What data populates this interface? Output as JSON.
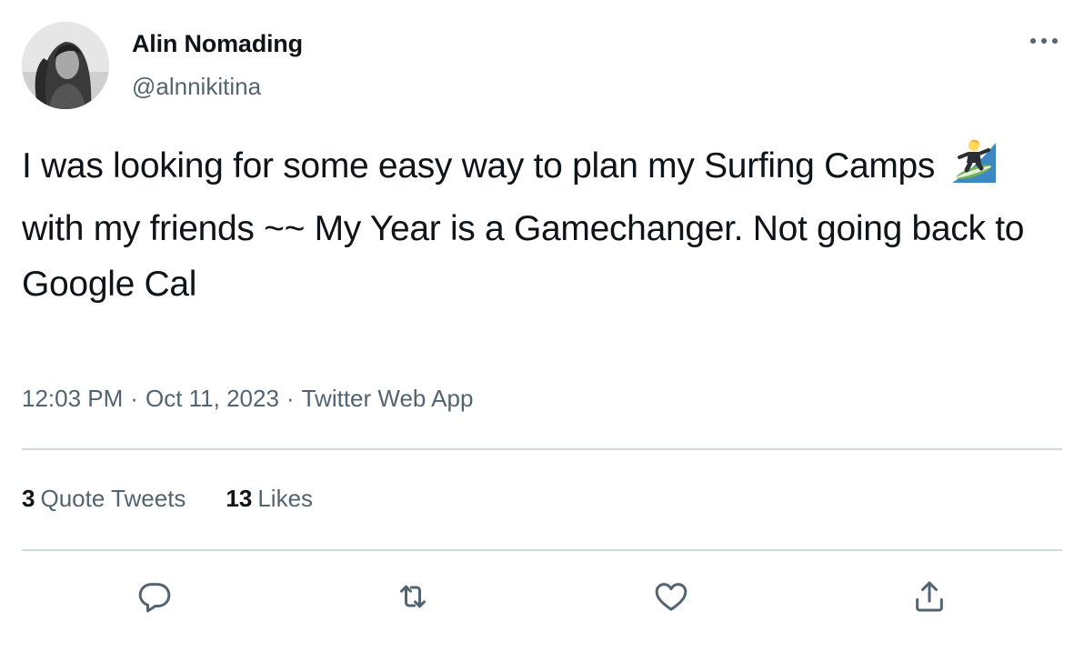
{
  "author": {
    "name": "Alin Nomading",
    "handle": "@alnnikitina"
  },
  "tweet": {
    "text_part1": "I was looking for some easy way to plan my Surfing Camps",
    "emoji": "surfer-emoji",
    "text_part2": "with my friends ~~ My Year is a Gamechanger. Not going back to Google Cal"
  },
  "meta": {
    "time": "12:03 PM",
    "separator": "·",
    "date": "Oct 11, 2023",
    "source": "Twitter Web App"
  },
  "stats": [
    {
      "count": "3",
      "label": "Quote Tweets"
    },
    {
      "count": "13",
      "label": "Likes"
    }
  ],
  "icons": {
    "more": "more-horizontal-icon",
    "reply": "reply-icon",
    "retweet": "retweet-icon",
    "like": "heart-icon",
    "share": "share-icon"
  },
  "colors": {
    "text_primary": "#0f1419",
    "text_secondary": "#536471",
    "divider": "#cfd9de"
  }
}
